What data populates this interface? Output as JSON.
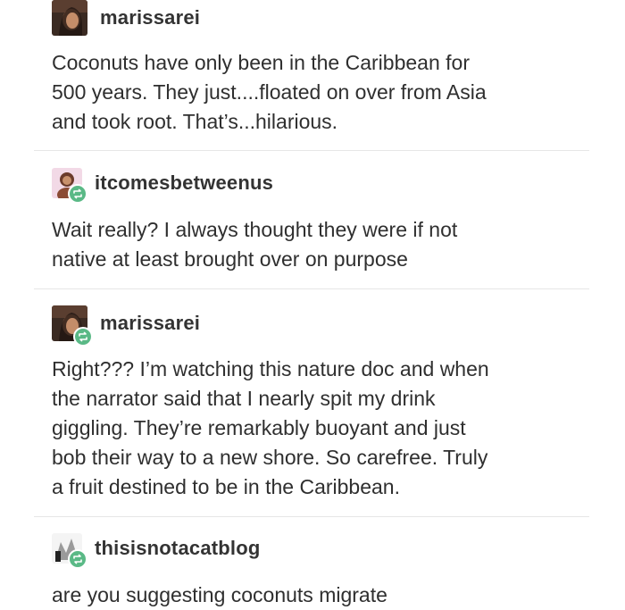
{
  "posts": [
    {
      "username": "marissarei",
      "avatar_icon": "user-avatar-icon",
      "reblog": false,
      "lines": [
        "Coconuts have only been in the Caribbean for",
        "500 years. They just....floated on over from Asia",
        "and took root. That’s...hilarious."
      ]
    },
    {
      "username": "itcomesbetweenus",
      "avatar_icon": "user-avatar-icon",
      "reblog": true,
      "lines": [
        "Wait really? I always thought they were if not",
        "native at least brought over on purpose"
      ]
    },
    {
      "username": "marissarei",
      "avatar_icon": "user-avatar-icon",
      "reblog": true,
      "lines": [
        "Right??? I’m watching this nature doc and when",
        "the narrator said that I nearly spit my drink",
        "giggling. They’re remarkably buoyant and just",
        "bob their way to a new shore. So carefree. Truly",
        "a fruit destined to be in the Caribbean."
      ]
    },
    {
      "username": "thisisnotacatblog",
      "avatar_icon": "user-avatar-icon",
      "reblog": true,
      "lines": [
        "are you suggesting coconuts migrate"
      ]
    }
  ],
  "colors": {
    "reblog_badge": "#5ab986",
    "username": "#333333",
    "text": "#2f2f2f",
    "divider": "#e6e6e6"
  }
}
